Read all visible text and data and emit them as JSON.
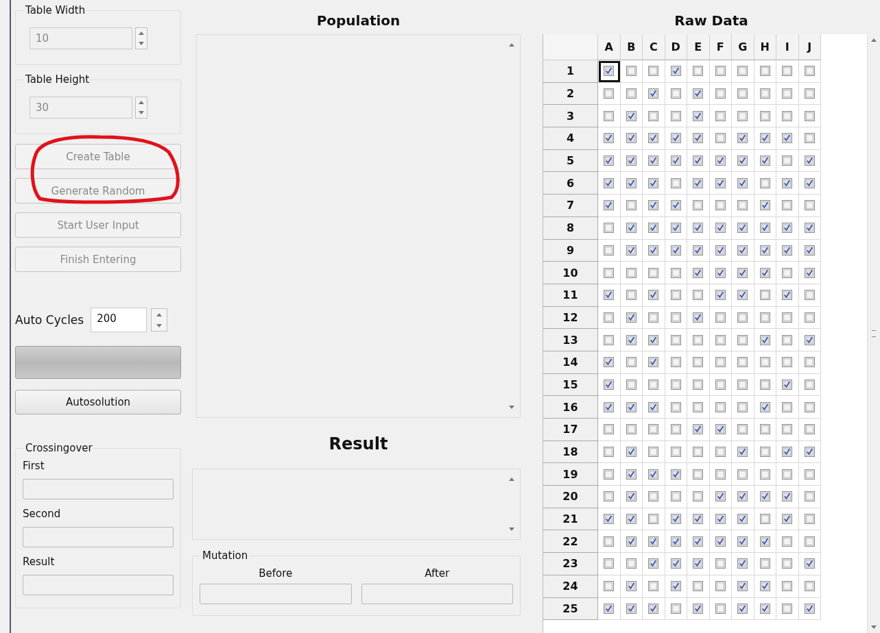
{
  "settings": {
    "table_width": {
      "label": "Table Width",
      "value": "10",
      "disabled": true
    },
    "table_height": {
      "label": "Table Height",
      "value": "30",
      "disabled": true
    },
    "buttons": [
      {
        "label": "Create Table",
        "disabled": true
      },
      {
        "label": "Generate Random",
        "disabled": true
      },
      {
        "label": "Start User Input",
        "disabled": true
      },
      {
        "label": "Finish Entering",
        "disabled": true
      }
    ],
    "annotation": {
      "kind": "ellipse"
    },
    "auto_cycles": {
      "label": "Auto Cycles",
      "value": "200"
    },
    "autosolution": {
      "label": "Autosolution"
    }
  },
  "crossingover": {
    "title": "Crossingover",
    "fields": [
      {
        "label": "First"
      },
      {
        "label": "Second"
      },
      {
        "label": "Result"
      }
    ]
  },
  "population": {
    "title": "Population"
  },
  "result": {
    "title": "Result"
  },
  "mutation": {
    "title": "Mutation",
    "fields": [
      {
        "label": "Before"
      },
      {
        "label": "After"
      }
    ]
  },
  "raw_data": {
    "title": "Raw Data",
    "columns": [
      "A",
      "B",
      "C",
      "D",
      "E",
      "F",
      "G",
      "H",
      "I",
      "J"
    ],
    "rows": [
      {
        "label": "1",
        "focused": true,
        "cells": [
          true,
          false,
          false,
          true,
          false,
          false,
          false,
          false,
          false,
          false
        ]
      },
      {
        "label": "2",
        "focused": false,
        "cells": [
          false,
          false,
          true,
          false,
          true,
          false,
          false,
          false,
          false,
          false
        ]
      },
      {
        "label": "3",
        "focused": false,
        "cells": [
          false,
          true,
          false,
          false,
          true,
          false,
          false,
          false,
          false,
          false
        ]
      },
      {
        "label": "4",
        "focused": false,
        "cells": [
          true,
          true,
          true,
          true,
          true,
          false,
          true,
          true,
          true,
          false
        ]
      },
      {
        "label": "5",
        "focused": false,
        "cells": [
          true,
          true,
          true,
          true,
          true,
          true,
          true,
          true,
          false,
          true
        ]
      },
      {
        "label": "6",
        "focused": false,
        "cells": [
          true,
          true,
          true,
          false,
          true,
          true,
          true,
          false,
          true,
          true
        ]
      },
      {
        "label": "7",
        "focused": false,
        "cells": [
          true,
          false,
          true,
          true,
          false,
          false,
          false,
          true,
          false,
          false
        ]
      },
      {
        "label": "8",
        "focused": false,
        "cells": [
          false,
          true,
          true,
          true,
          true,
          true,
          true,
          true,
          true,
          true
        ]
      },
      {
        "label": "9",
        "focused": false,
        "cells": [
          false,
          true,
          true,
          true,
          true,
          true,
          true,
          true,
          true,
          true
        ]
      },
      {
        "label": "10",
        "focused": false,
        "cells": [
          false,
          false,
          false,
          false,
          true,
          true,
          true,
          true,
          false,
          true
        ]
      },
      {
        "label": "11",
        "focused": false,
        "cells": [
          true,
          false,
          true,
          false,
          false,
          true,
          true,
          false,
          true,
          false
        ]
      },
      {
        "label": "12",
        "focused": false,
        "cells": [
          false,
          true,
          false,
          false,
          true,
          false,
          false,
          false,
          false,
          false
        ]
      },
      {
        "label": "13",
        "focused": false,
        "cells": [
          false,
          true,
          true,
          false,
          false,
          false,
          false,
          true,
          false,
          true
        ]
      },
      {
        "label": "14",
        "focused": false,
        "cells": [
          true,
          false,
          true,
          false,
          false,
          false,
          false,
          false,
          false,
          false
        ]
      },
      {
        "label": "15",
        "focused": false,
        "cells": [
          true,
          false,
          false,
          false,
          false,
          false,
          false,
          false,
          true,
          false
        ]
      },
      {
        "label": "16",
        "focused": false,
        "cells": [
          true,
          true,
          true,
          false,
          false,
          false,
          false,
          true,
          false,
          false
        ]
      },
      {
        "label": "17",
        "focused": false,
        "cells": [
          false,
          false,
          false,
          false,
          true,
          true,
          false,
          false,
          false,
          false
        ]
      },
      {
        "label": "18",
        "focused": false,
        "cells": [
          false,
          true,
          false,
          false,
          false,
          false,
          true,
          false,
          true,
          true
        ]
      },
      {
        "label": "19",
        "focused": false,
        "cells": [
          false,
          true,
          true,
          true,
          false,
          false,
          false,
          false,
          false,
          false
        ]
      },
      {
        "label": "20",
        "focused": false,
        "cells": [
          false,
          true,
          false,
          false,
          false,
          true,
          true,
          true,
          true,
          false
        ]
      },
      {
        "label": "21",
        "focused": false,
        "cells": [
          true,
          true,
          false,
          true,
          true,
          true,
          true,
          false,
          true,
          false
        ]
      },
      {
        "label": "22",
        "focused": false,
        "cells": [
          false,
          true,
          true,
          true,
          true,
          true,
          true,
          true,
          false,
          false
        ]
      },
      {
        "label": "23",
        "focused": false,
        "cells": [
          false,
          false,
          true,
          true,
          true,
          false,
          true,
          false,
          false,
          true
        ]
      },
      {
        "label": "24",
        "focused": false,
        "cells": [
          false,
          true,
          false,
          true,
          false,
          false,
          true,
          true,
          false,
          false
        ]
      },
      {
        "label": "25",
        "focused": false,
        "cells": [
          true,
          true,
          true,
          false,
          true,
          false,
          true,
          true,
          false,
          true
        ]
      }
    ]
  }
}
